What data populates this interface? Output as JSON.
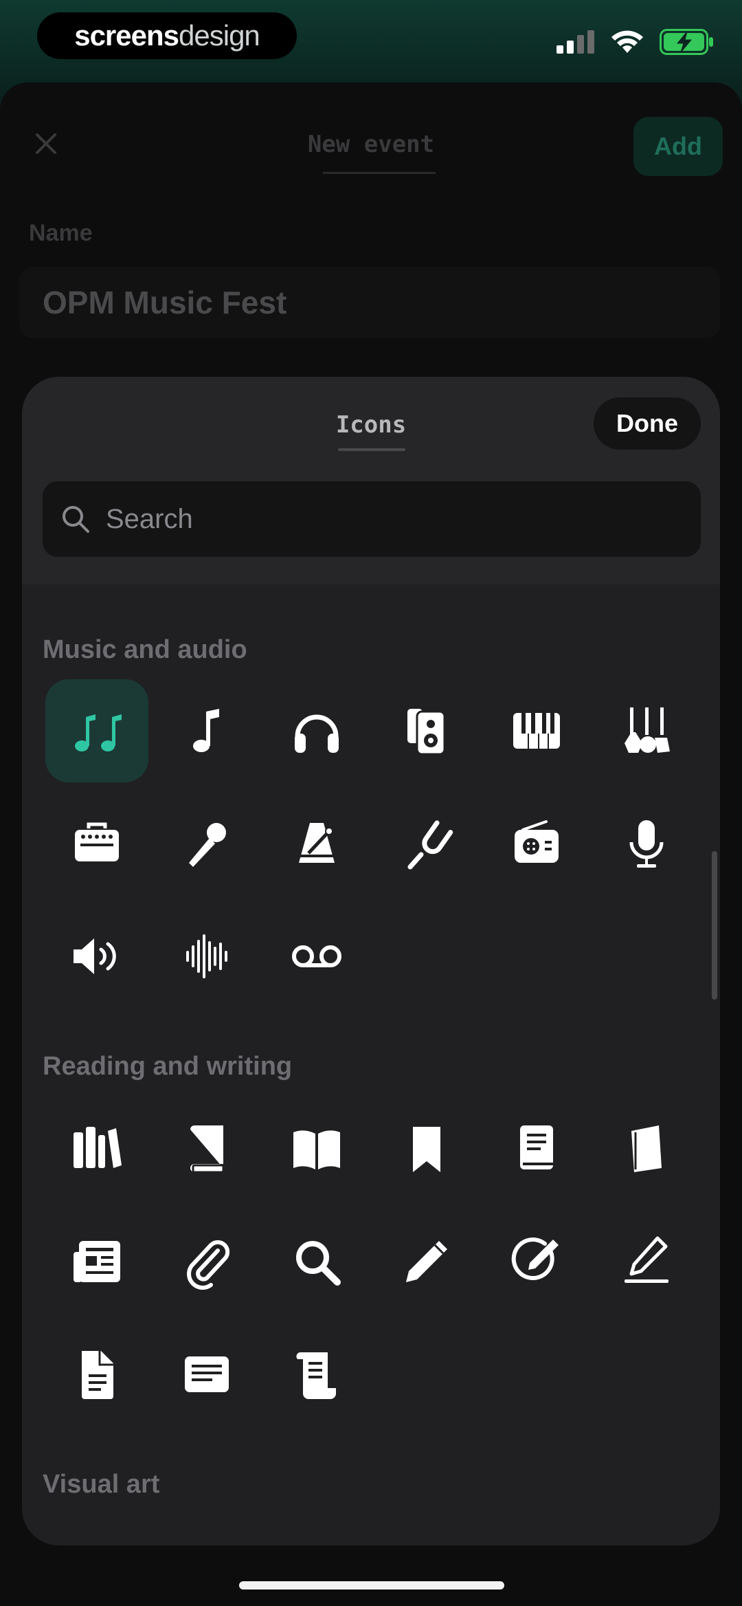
{
  "status_bar": {
    "brand_part1": "screens",
    "brand_part2": "design"
  },
  "background_sheet": {
    "title": "New event",
    "add_label": "Add",
    "name_label": "Name",
    "name_value": "OPM Music Fest"
  },
  "icons_sheet": {
    "title": "Icons",
    "done_label": "Done",
    "search_placeholder": "Search",
    "sections": [
      {
        "title": "Music and audio",
        "icons": [
          "music-notes-icon",
          "music-note-icon",
          "headphones-icon",
          "speaker-icon",
          "piano-keys-icon",
          "guitars-icon",
          "amplifier-icon",
          "microphone-handheld-icon",
          "metronome-icon",
          "tuning-fork-icon",
          "radio-icon",
          "microphone-icon",
          "speaker-wave-icon",
          "waveform-icon",
          "voicemail-icon"
        ],
        "selected": "music-notes-icon"
      },
      {
        "title": "Reading and writing",
        "icons": [
          "books-icon",
          "book-closed-icon",
          "book-open-icon",
          "bookmark-icon",
          "text-book-icon",
          "notebook-icon",
          "newspaper-icon",
          "paperclip-icon",
          "magnifier-icon",
          "pencil-icon",
          "pencil-circle-icon",
          "pencil-line-icon",
          "document-icon",
          "text-box-icon",
          "scroll-icon"
        ]
      },
      {
        "title": "Visual art",
        "icons": []
      }
    ]
  },
  "colors": {
    "accent": "#2fc6a4",
    "sheet_bg": "#202022",
    "battery": "#34c759"
  }
}
